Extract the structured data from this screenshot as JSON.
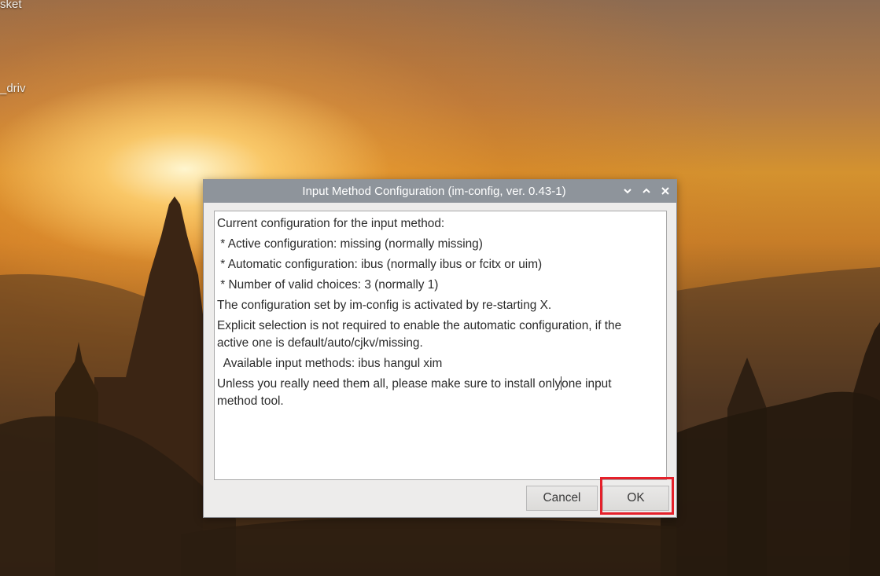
{
  "desktop": {
    "icon_labels": [
      "sket",
      "_driv"
    ]
  },
  "dialog": {
    "title": "Input Method Configuration (im-config, ver. 0.43-1)",
    "window_controls": {
      "minimize_icon": "chevron-down-icon",
      "maximize_icon": "chevron-up-icon",
      "close_icon": "close-icon"
    },
    "message": {
      "line1": "Current configuration for the input method:",
      "line2": " * Active configuration: missing (normally missing)",
      "line3": " * Automatic configuration: ibus (normally ibus or fcitx or uim)",
      "line4": " * Number of valid choices: 3 (normally 1)",
      "line5": "The configuration set by im-config is activated by re-starting X.",
      "line6": "Explicit selection is not required to enable the automatic configuration, if the",
      "line7": "active one is default/auto/cjkv/missing.",
      "line8": "  Available input methods: ibus hangul xim",
      "line9a": "Unless you really need them all, please make sure to install only",
      "line9b": "one input",
      "line10": "method tool."
    },
    "buttons": {
      "cancel": "Cancel",
      "ok": "OK"
    }
  },
  "colors": {
    "titlebar": "#8e949b",
    "highlight": "#e5202a"
  }
}
